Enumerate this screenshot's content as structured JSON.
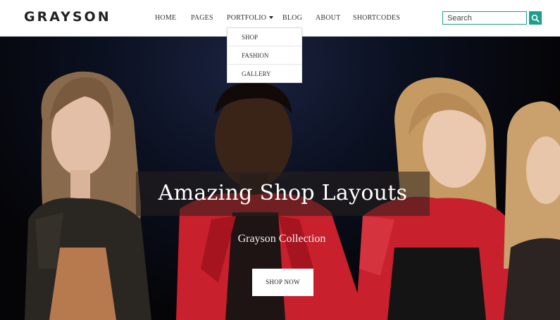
{
  "brand": {
    "logo": "GRAYSON"
  },
  "nav": {
    "items": [
      {
        "label": "HOME"
      },
      {
        "label": "PAGES"
      },
      {
        "label": "PORTFOLIO"
      },
      {
        "label": "BLOG"
      },
      {
        "label": "ABOUT"
      },
      {
        "label": "SHORTCODES"
      }
    ],
    "portfolio_dropdown": [
      "SHOP",
      "FASHION",
      "GALLERY"
    ]
  },
  "search": {
    "placeholder": "Search"
  },
  "hero": {
    "headline": "Amazing Shop Layouts",
    "subheadline": "Grayson Collection",
    "cta_label": "SHOP NOW"
  },
  "colors": {
    "accent": "#1a9e8f",
    "red_garment": "#c8202c"
  }
}
